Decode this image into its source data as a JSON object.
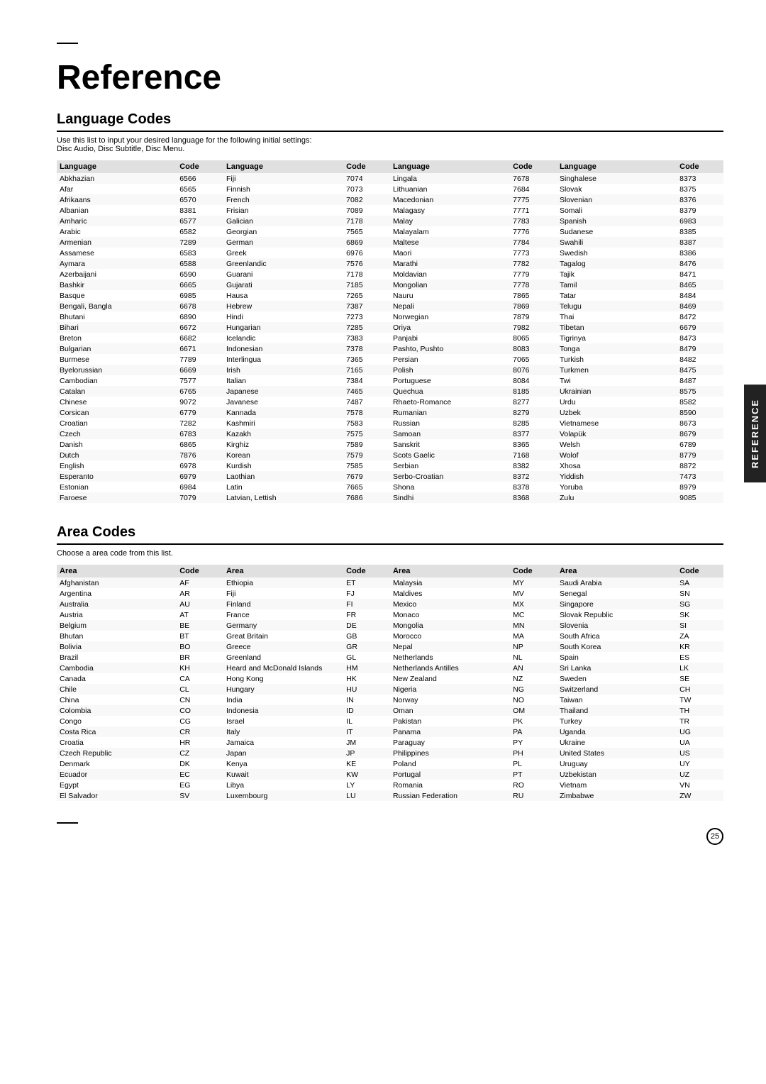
{
  "page": {
    "title": "Reference",
    "page_number": "25",
    "side_tab": "REFERENCE"
  },
  "language_codes": {
    "title": "Language Codes",
    "description": "Use this list to input your desired language for the following initial settings:",
    "description2": "Disc Audio, Disc Subtitle, Disc Menu.",
    "col_headers": [
      "Language",
      "Code",
      "Language",
      "Code",
      "Language",
      "Code",
      "Language",
      "Code"
    ],
    "rows": [
      [
        "Abkhazian",
        "6566",
        "Fiji",
        "7074",
        "Lingala",
        "7678",
        "Singhalese",
        "8373"
      ],
      [
        "Afar",
        "6565",
        "Finnish",
        "7073",
        "Lithuanian",
        "7684",
        "Slovak",
        "8375"
      ],
      [
        "Afrikaans",
        "6570",
        "French",
        "7082",
        "Macedonian",
        "7775",
        "Slovenian",
        "8376"
      ],
      [
        "Albanian",
        "8381",
        "Frisian",
        "7089",
        "Malagasy",
        "7771",
        "Somali",
        "8379"
      ],
      [
        "Amharic",
        "6577",
        "Galician",
        "7178",
        "Malay",
        "7783",
        "Spanish",
        "6983"
      ],
      [
        "Arabic",
        "6582",
        "Georgian",
        "7565",
        "Malayalam",
        "7776",
        "Sudanese",
        "8385"
      ],
      [
        "Armenian",
        "7289",
        "German",
        "6869",
        "Maltese",
        "7784",
        "Swahili",
        "8387"
      ],
      [
        "Assamese",
        "6583",
        "Greek",
        "6976",
        "Maori",
        "7773",
        "Swedish",
        "8386"
      ],
      [
        "Aymara",
        "6588",
        "Greenlandic",
        "7576",
        "Marathi",
        "7782",
        "Tagalog",
        "8476"
      ],
      [
        "Azerbaijani",
        "6590",
        "Guarani",
        "7178",
        "Moldavian",
        "7779",
        "Tajik",
        "8471"
      ],
      [
        "Bashkir",
        "6665",
        "Gujarati",
        "7185",
        "Mongolian",
        "7778",
        "Tamil",
        "8465"
      ],
      [
        "Basque",
        "6985",
        "Hausa",
        "7265",
        "Nauru",
        "7865",
        "Tatar",
        "8484"
      ],
      [
        "Bengali, Bangla",
        "6678",
        "Hebrew",
        "7387",
        "Nepali",
        "7869",
        "Telugu",
        "8469"
      ],
      [
        "Bhutani",
        "6890",
        "Hindi",
        "7273",
        "Norwegian",
        "7879",
        "Thai",
        "8472"
      ],
      [
        "Bihari",
        "6672",
        "Hungarian",
        "7285",
        "Oriya",
        "7982",
        "Tibetan",
        "6679"
      ],
      [
        "Breton",
        "6682",
        "Icelandic",
        "7383",
        "Panjabi",
        "8065",
        "Tigrinya",
        "8473"
      ],
      [
        "Bulgarian",
        "6671",
        "Indonesian",
        "7378",
        "Pashto, Pushto",
        "8083",
        "Tonga",
        "8479"
      ],
      [
        "Burmese",
        "7789",
        "Interlingua",
        "7365",
        "Persian",
        "7065",
        "Turkish",
        "8482"
      ],
      [
        "Byelorussian",
        "6669",
        "Irish",
        "7165",
        "Polish",
        "8076",
        "Turkmen",
        "8475"
      ],
      [
        "Cambodian",
        "7577",
        "Italian",
        "7384",
        "Portuguese",
        "8084",
        "Twi",
        "8487"
      ],
      [
        "Catalan",
        "6765",
        "Japanese",
        "7465",
        "Quechua",
        "8185",
        "Ukrainian",
        "8575"
      ],
      [
        "Chinese",
        "9072",
        "Javanese",
        "7487",
        "Rhaeto-Romance",
        "8277",
        "Urdu",
        "8582"
      ],
      [
        "Corsican",
        "6779",
        "Kannada",
        "7578",
        "Rumanian",
        "8279",
        "Uzbek",
        "8590"
      ],
      [
        "Croatian",
        "7282",
        "Kashmiri",
        "7583",
        "Russian",
        "8285",
        "Vietnamese",
        "8673"
      ],
      [
        "Czech",
        "6783",
        "Kazakh",
        "7575",
        "Samoan",
        "8377",
        "Volapük",
        "8679"
      ],
      [
        "Danish",
        "6865",
        "Kirghiz",
        "7589",
        "Sanskrit",
        "8365",
        "Welsh",
        "6789"
      ],
      [
        "Dutch",
        "7876",
        "Korean",
        "7579",
        "Scots Gaelic",
        "7168",
        "Wolof",
        "8779"
      ],
      [
        "English",
        "6978",
        "Kurdish",
        "7585",
        "Serbian",
        "8382",
        "Xhosa",
        "8872"
      ],
      [
        "Esperanto",
        "6979",
        "Laothian",
        "7679",
        "Serbo-Croatian",
        "8372",
        "Yiddish",
        "7473"
      ],
      [
        "Estonian",
        "6984",
        "Latin",
        "7665",
        "Shona",
        "8378",
        "Yoruba",
        "8979"
      ],
      [
        "Faroese",
        "7079",
        "Latvian, Lettish",
        "7686",
        "Sindhi",
        "8368",
        "Zulu",
        "9085"
      ]
    ]
  },
  "area_codes": {
    "title": "Area Codes",
    "description": "Choose a area code from this list.",
    "col_headers": [
      "Area",
      "Code",
      "Area",
      "Code",
      "Area",
      "Code",
      "Area",
      "Code"
    ],
    "rows": [
      [
        "Afghanistan",
        "AF",
        "Ethiopia",
        "ET",
        "Malaysia",
        "MY",
        "Saudi Arabia",
        "SA"
      ],
      [
        "Argentina",
        "AR",
        "Fiji",
        "FJ",
        "Maldives",
        "MV",
        "Senegal",
        "SN"
      ],
      [
        "Australia",
        "AU",
        "Finland",
        "FI",
        "Mexico",
        "MX",
        "Singapore",
        "SG"
      ],
      [
        "Austria",
        "AT",
        "France",
        "FR",
        "Monaco",
        "MC",
        "Slovak Republic",
        "SK"
      ],
      [
        "Belgium",
        "BE",
        "Germany",
        "DE",
        "Mongolia",
        "MN",
        "Slovenia",
        "SI"
      ],
      [
        "Bhutan",
        "BT",
        "Great Britain",
        "GB",
        "Morocco",
        "MA",
        "South Africa",
        "ZA"
      ],
      [
        "Bolivia",
        "BO",
        "Greece",
        "GR",
        "Nepal",
        "NP",
        "South Korea",
        "KR"
      ],
      [
        "Brazil",
        "BR",
        "Greenland",
        "GL",
        "Netherlands",
        "NL",
        "Spain",
        "ES"
      ],
      [
        "Cambodia",
        "KH",
        "Heard and McDonald Islands",
        "HM",
        "Netherlands Antilles",
        "AN",
        "Sri Lanka",
        "LK"
      ],
      [
        "Canada",
        "CA",
        "Hong Kong",
        "HK",
        "New Zealand",
        "NZ",
        "Sweden",
        "SE"
      ],
      [
        "Chile",
        "CL",
        "Hungary",
        "HU",
        "Nigeria",
        "NG",
        "Switzerland",
        "CH"
      ],
      [
        "China",
        "CN",
        "India",
        "IN",
        "Norway",
        "NO",
        "Taiwan",
        "TW"
      ],
      [
        "Colombia",
        "CO",
        "Indonesia",
        "ID",
        "Oman",
        "OM",
        "Thailand",
        "TH"
      ],
      [
        "Congo",
        "CG",
        "Israel",
        "IL",
        "Pakistan",
        "PK",
        "Turkey",
        "TR"
      ],
      [
        "Costa Rica",
        "CR",
        "Italy",
        "IT",
        "Panama",
        "PA",
        "Uganda",
        "UG"
      ],
      [
        "Croatia",
        "HR",
        "Jamaica",
        "JM",
        "Paraguay",
        "PY",
        "Ukraine",
        "UA"
      ],
      [
        "Czech Republic",
        "CZ",
        "Japan",
        "JP",
        "Philippines",
        "PH",
        "United States",
        "US"
      ],
      [
        "Denmark",
        "DK",
        "Kenya",
        "KE",
        "Poland",
        "PL",
        "Uruguay",
        "UY"
      ],
      [
        "Ecuador",
        "EC",
        "Kuwait",
        "KW",
        "Portugal",
        "PT",
        "Uzbekistan",
        "UZ"
      ],
      [
        "Egypt",
        "EG",
        "Libya",
        "LY",
        "Romania",
        "RO",
        "Vietnam",
        "VN"
      ],
      [
        "El Salvador",
        "SV",
        "Luxembourg",
        "LU",
        "Russian Federation",
        "RU",
        "Zimbabwe",
        "ZW"
      ]
    ]
  }
}
